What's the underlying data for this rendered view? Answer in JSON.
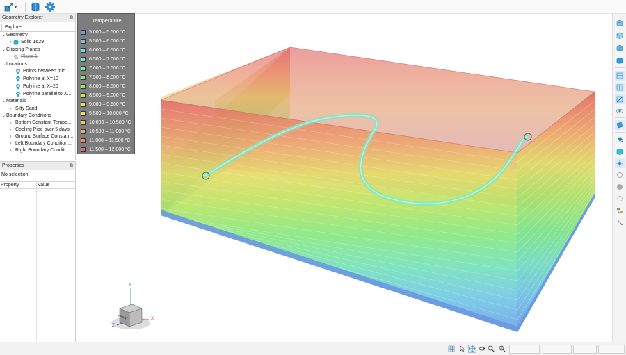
{
  "toolbar": {
    "icons": [
      "axis-transform-icon",
      "chevron-down-icon",
      "solid-book-icon",
      "gear-icon"
    ]
  },
  "explorer": {
    "title": "Geometry Explorer",
    "tab": "Explorer",
    "tree": [
      {
        "label": "Geometry",
        "level": 0,
        "expanded": true,
        "icon": "none"
      },
      {
        "label": "Solid 1629",
        "level": 1,
        "expanded": false,
        "icon": "solid-icon"
      },
      {
        "label": "Clipping Planes",
        "level": 0,
        "expanded": true,
        "icon": "none"
      },
      {
        "label": "Plane 1",
        "level": 1,
        "expanded": false,
        "icon": "plane-icon",
        "disabled": true
      },
      {
        "label": "Locations",
        "level": 0,
        "expanded": true,
        "icon": "none"
      },
      {
        "label": "Points between mid...",
        "level": 1,
        "expanded": false,
        "icon": "location-pin-icon"
      },
      {
        "label": "Polyline at X=10",
        "level": 1,
        "expanded": false,
        "icon": "location-pin-icon"
      },
      {
        "label": "Polyline at X=20",
        "level": 1,
        "expanded": false,
        "icon": "location-pin-icon"
      },
      {
        "label": "Polyline parallel to X...",
        "level": 1,
        "expanded": false,
        "icon": "location-pin-icon"
      },
      {
        "label": "Materials",
        "level": 0,
        "expanded": true,
        "icon": "none"
      },
      {
        "label": "Silty Sand",
        "level": 1,
        "expanded": false,
        "icon": "none"
      },
      {
        "label": "Boundary Conditions",
        "level": 0,
        "expanded": true,
        "icon": "none"
      },
      {
        "label": "Bottom Constant Tempe...",
        "level": 1,
        "expanded": false,
        "icon": "none"
      },
      {
        "label": "Cooling Pipe over 5 days",
        "level": 1,
        "expanded": false,
        "icon": "none"
      },
      {
        "label": "Ground Surface Constan...",
        "level": 1,
        "expanded": false,
        "icon": "none"
      },
      {
        "label": "Left Boundary Condition...",
        "level": 1,
        "expanded": false,
        "icon": "none"
      },
      {
        "label": "Right Boundary Conditi...",
        "level": 1,
        "expanded": false,
        "icon": "none"
      }
    ]
  },
  "properties": {
    "title": "Properties",
    "selection": "No selection",
    "col_property": "Property",
    "col_value": "Value"
  },
  "legend": {
    "title": "Temperature",
    "items": [
      {
        "label": "5.000 – 5.500 °C",
        "color": "#6c9ce6"
      },
      {
        "label": "5.500 – 6.000 °C",
        "color": "#6cc3ee"
      },
      {
        "label": "6.000 – 6.500 °C",
        "color": "#6ae0e8"
      },
      {
        "label": "6.500 – 7.000 °C",
        "color": "#6ee6c8"
      },
      {
        "label": "7.000 – 7.500 °C",
        "color": "#74ea9e"
      },
      {
        "label": "7.500 – 8.000 °C",
        "color": "#7eea76"
      },
      {
        "label": "8.000 – 8.500 °C",
        "color": "#9aea64"
      },
      {
        "label": "8.500 – 9.000 °C",
        "color": "#bde85e"
      },
      {
        "label": "9.000 – 9.500 °C",
        "color": "#dce75e"
      },
      {
        "label": "9.500 – 10.000 °C",
        "color": "#f0df62"
      },
      {
        "label": "10.000 – 10.500 °C",
        "color": "#f3c864"
      },
      {
        "label": "10.500 – 11.000 °C",
        "color": "#f2ab66"
      },
      {
        "label": "11.000 – 11.500 °C",
        "color": "#ef8a66"
      },
      {
        "label": "11.500 – 12.000 °C",
        "color": "#e86468"
      }
    ]
  },
  "view_cube": {
    "face": "FRONT",
    "axis_y": "Y",
    "axis_x": "X",
    "axis_z": "Z"
  },
  "right_toolbar": {
    "icons": [
      "view-top-icon",
      "view-front-icon",
      "view-right-icon",
      "view-iso-icon",
      "section-x-icon",
      "section-y-icon",
      "section-z-icon",
      "eye-icon",
      "clip-plane-icon",
      "color-fill-icon",
      "material-cube-icon",
      "probe-icon",
      "circle-outline-icon",
      "circle-filled-icon",
      "circle-dashed-icon",
      "scene-tree-icon",
      "pointer-tool-icon"
    ]
  },
  "status_bar": {
    "icons": [
      "grid-icon",
      "pointer-icon",
      "pan-icon",
      "rotate-icon",
      "zoom-icon",
      "zoom-box-icon"
    ]
  }
}
